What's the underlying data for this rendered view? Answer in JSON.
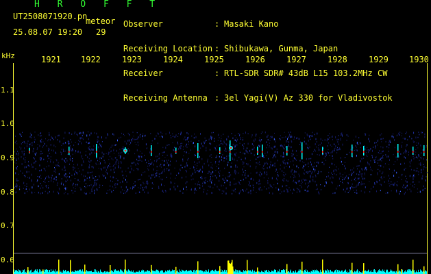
{
  "header": {
    "app_title": "H R O F F T",
    "file_name": "UT2508071920.pn",
    "meteor_label": "meteor",
    "date_time": "25.08.07 19:20",
    "count": "29"
  },
  "meta": {
    "labels": [
      "Observer",
      "Receiving Location",
      "Receiver",
      "Receiving Antenna"
    ],
    "colons": [
      ":",
      ":",
      ":",
      ":"
    ],
    "values": [
      "Masaki Kano",
      "Shibukawa, Gunma, Japan",
      "RTL-SDR SDR# 43dB L15 103.2MHz CW",
      "3el Yagi(V) Az 330 for Vladivostok"
    ]
  },
  "axes": {
    "freq_unit": "kHz",
    "freq_ticks": [
      "1.1",
      "1.0",
      "0.9",
      "0.8",
      "0.7",
      "0.6"
    ],
    "time_ticks": [
      "1921",
      "1922",
      "1923",
      "1924",
      "1925",
      "1926",
      "1927",
      "1928",
      "1929",
      "1930"
    ]
  },
  "colors": {
    "header_green": "#33ff33",
    "text_yellow": "#ffff33",
    "noise_blue": "#2233aa",
    "signal_cyan": "#00ffff",
    "signal_red": "#ff2222",
    "histogram_yellow": "#ffff00"
  }
}
